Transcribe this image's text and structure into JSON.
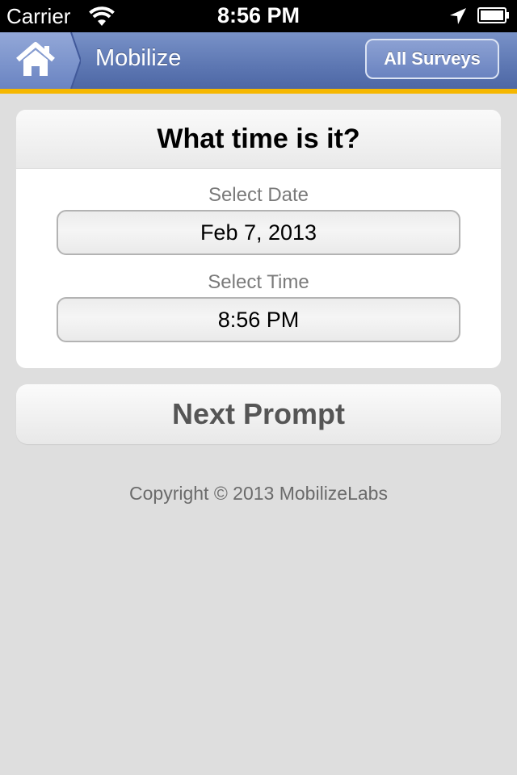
{
  "status_bar": {
    "carrier": "Carrier",
    "time": "8:56 PM"
  },
  "nav": {
    "title": "Mobilize",
    "all_surveys_label": "All Surveys",
    "home_icon": "home-icon"
  },
  "prompt": {
    "question": "What time is it?",
    "date_label": "Select Date",
    "date_value": "Feb 7, 2013",
    "time_label": "Select Time",
    "time_value": "8:56 PM"
  },
  "actions": {
    "next_label": "Next Prompt"
  },
  "footer": {
    "copyright": "Copyright © 2013 MobilizeLabs"
  },
  "colors": {
    "nav_bar": "#5f79b4",
    "nav_accent": "#f5b700",
    "background": "#dedede"
  }
}
